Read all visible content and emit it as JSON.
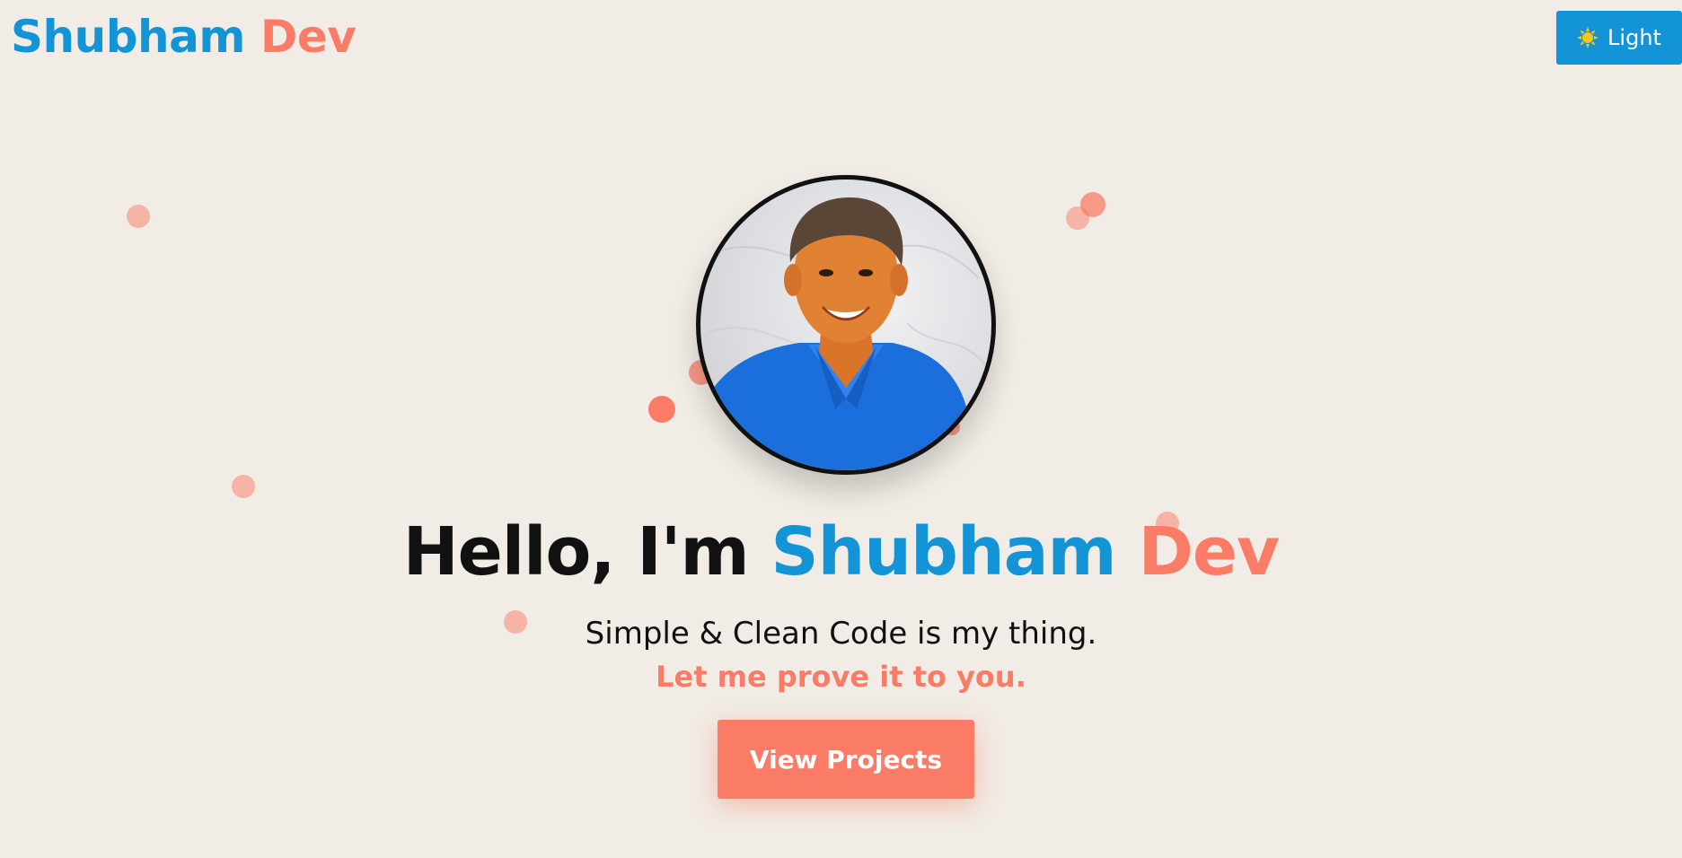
{
  "brand": {
    "first": "Shubham",
    "last": "Dev"
  },
  "theme_toggle": {
    "label": "Light",
    "icon": "sun-icon"
  },
  "hero": {
    "greeting": "Hello, I'm ",
    "name_first": "Shubham",
    "name_last": "Dev",
    "tagline": "Simple & Clean Code is my thing.",
    "subtagline": "Let me prove it to you.",
    "cta_label": "View Projects",
    "avatar": "profile-photo"
  },
  "colors": {
    "background": "#f1ece5",
    "primary": "#1394d6",
    "accent": "#fa7c67",
    "text": "#111111"
  }
}
